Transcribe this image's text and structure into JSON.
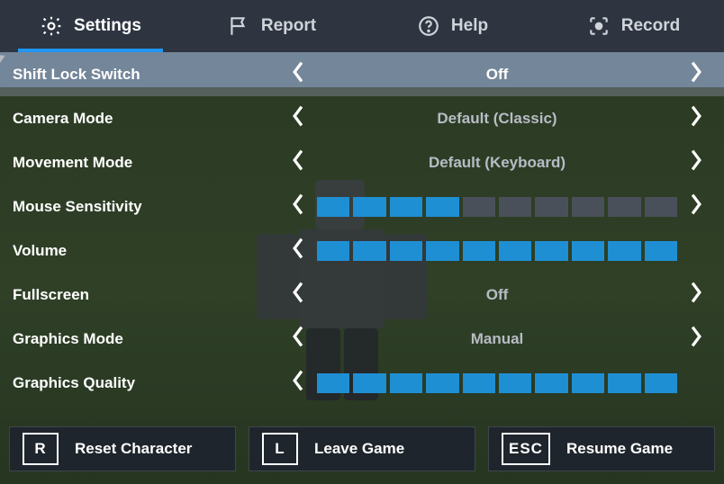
{
  "tabs": {
    "settings": "Settings",
    "report": "Report",
    "help": "Help",
    "record": "Record",
    "active": "settings"
  },
  "settings": [
    {
      "label": "Shift Lock Switch",
      "type": "value",
      "value": "Off",
      "highlight": true,
      "rightChevron": true
    },
    {
      "label": "Camera Mode",
      "type": "value",
      "value": "Default (Classic)",
      "rightChevron": true
    },
    {
      "label": "Movement Mode",
      "type": "value",
      "value": "Default (Keyboard)",
      "rightChevron": true
    },
    {
      "label": "Mouse Sensitivity",
      "type": "bars",
      "filled": 4,
      "total": 10,
      "rightChevron": true
    },
    {
      "label": "Volume",
      "type": "bars",
      "filled": 10,
      "total": 10,
      "rightChevron": false
    },
    {
      "label": "Fullscreen",
      "type": "value",
      "value": "Off",
      "rightChevron": true
    },
    {
      "label": "Graphics Mode",
      "type": "value",
      "value": "Manual",
      "rightChevron": true
    },
    {
      "label": "Graphics Quality",
      "type": "bars",
      "filled": 10,
      "total": 10,
      "rightChevron": false
    }
  ],
  "buttons": {
    "reset": {
      "key": "R",
      "label": "Reset Character"
    },
    "leave": {
      "key": "L",
      "label": "Leave Game"
    },
    "resume": {
      "key": "ESC",
      "label": "Resume Game"
    }
  },
  "colors": {
    "accent": "#1f8fd4",
    "tabUnderline": "#2196f3"
  }
}
